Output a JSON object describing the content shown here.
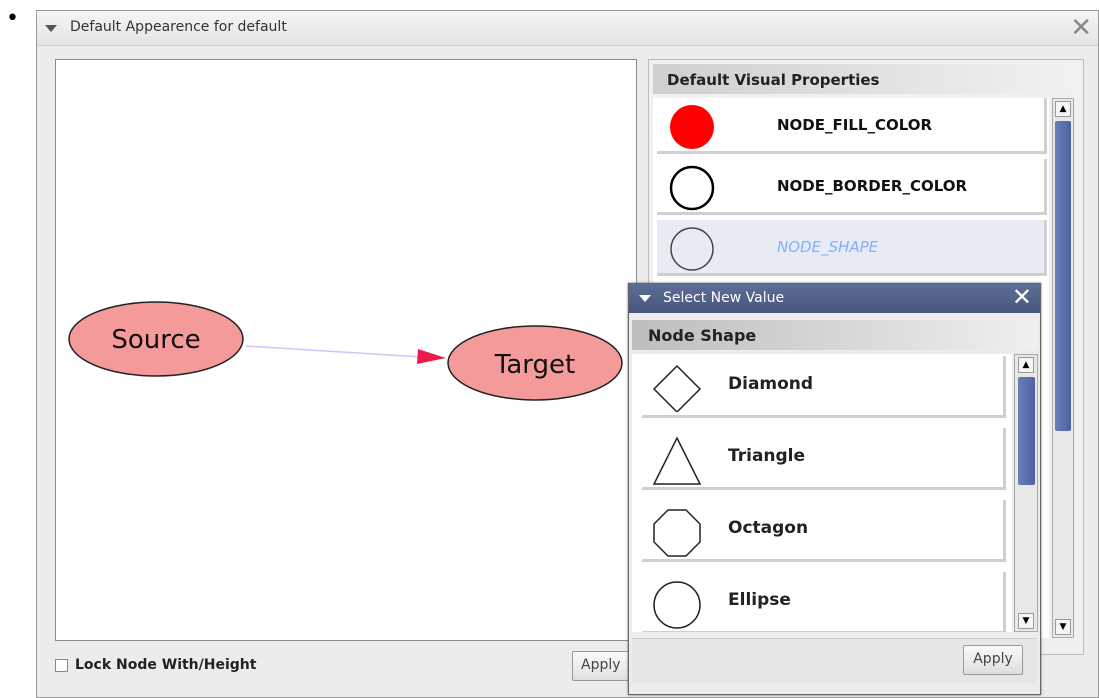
{
  "bullet": "•",
  "dialog": {
    "title": "Default Appearence for default",
    "close_glyph": "✕"
  },
  "network": {
    "source_label": "Source",
    "target_label": "Target",
    "node_fill": "#f59a9a",
    "edge_color": "#c8c8ff",
    "arrow_color": "#ee1b4a"
  },
  "lock": {
    "label": "Lock Node With/Height",
    "checked": false
  },
  "main_apply_label": "Apply",
  "visual_properties": {
    "header": "Default Visual Properties",
    "items": [
      {
        "name": "NODE_FILL_COLOR",
        "icon": "filled-red-circle-icon",
        "color": "#ff0000"
      },
      {
        "name": "NODE_BORDER_COLOR",
        "icon": "black-circle-outline-icon",
        "color": "#000000"
      },
      {
        "name": "NODE_SHAPE",
        "icon": "circle-outline-icon",
        "selected": true
      }
    ]
  },
  "popup": {
    "title": "Select New Value",
    "close_glyph": "✕",
    "header": "Node Shape",
    "options": [
      {
        "label": "Diamond",
        "icon": "diamond-icon"
      },
      {
        "label": "Triangle",
        "icon": "triangle-icon"
      },
      {
        "label": "Octagon",
        "icon": "octagon-icon"
      },
      {
        "label": "Ellipse",
        "icon": "ellipse-icon"
      }
    ],
    "apply_label": "Apply"
  }
}
